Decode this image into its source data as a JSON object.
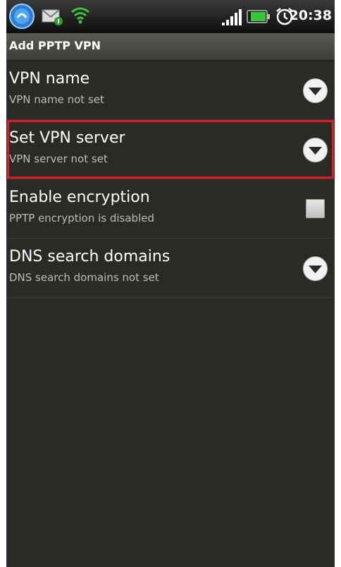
{
  "status_bar": {
    "time": "20:38",
    "icons": [
      "app-notification-icon",
      "email-notification-icon",
      "wifi-icon",
      "signal-icon",
      "battery-icon",
      "alarm-icon"
    ]
  },
  "title_bar": {
    "title": "Add PPTP VPN"
  },
  "settings": [
    {
      "title": "VPN name",
      "summary": "VPN name not set",
      "control": "dropdown-arrow-icon"
    },
    {
      "title": "Set VPN server",
      "summary": "VPN server not set",
      "control": "dropdown-arrow-icon",
      "highlighted": true
    },
    {
      "title": "Enable encryption",
      "summary": "PPTP encryption is disabled",
      "control": "checkbox",
      "checked": false
    },
    {
      "title": "DNS search domains",
      "summary": "DNS search domains not set",
      "control": "dropdown-arrow-icon"
    }
  ],
  "colors": {
    "background": "#2b2a26",
    "title_bar": "#4d4d47",
    "highlight_border": "#e11b22",
    "summary_text": "#bdbdb6"
  }
}
